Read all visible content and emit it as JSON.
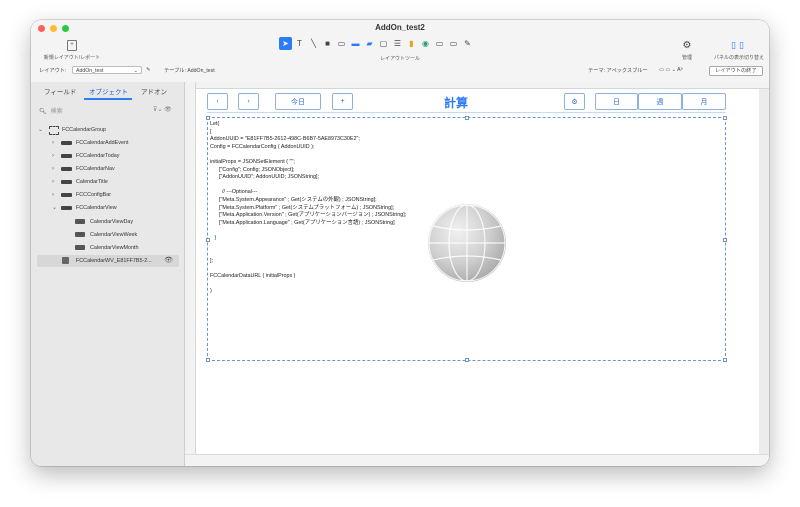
{
  "window": {
    "title": "AddOn_test2"
  },
  "toolbar": {
    "new_layout_label": "新規レイアウト/レポート",
    "tools_label": "レイアウトツール",
    "manage_label": "管理",
    "panels_label": "パネルの表示切り替え",
    "tools": [
      "pointer",
      "text",
      "line",
      "rectangle",
      "field",
      "button",
      "button-bar",
      "popover",
      "portal",
      "chart",
      "web-viewer",
      "tab-control",
      "slide-control",
      "format-painter"
    ]
  },
  "layout_bar": {
    "layout_label": "レイアウト:",
    "layout_value": "AddOn_test",
    "table_label": "テーブル: AddOn_test",
    "theme_label": "テーマ: アペックスブルー",
    "exit_label": "レイアウトの終了"
  },
  "sidebar": {
    "tabs": [
      "フィールド",
      "オブジェクト",
      "アドオン"
    ],
    "active_tab": "オブジェクト",
    "search_placeholder": "検索",
    "tree": [
      {
        "label": "FCCalendarGroup",
        "level": 0,
        "icon": "group-icon",
        "expanded": true
      },
      {
        "label": "FCCalendarAddEvent",
        "level": 1,
        "icon": "object-icon",
        "expanded": false
      },
      {
        "label": "FCCalendarToday",
        "level": 1,
        "icon": "object-icon",
        "expanded": false
      },
      {
        "label": "FCCalendarNav",
        "level": 1,
        "icon": "object-icon",
        "expanded": false
      },
      {
        "label": "CalendarTitle",
        "level": 1,
        "icon": "object-icon",
        "expanded": false
      },
      {
        "label": "FCCConfigBar",
        "level": 1,
        "icon": "object-icon",
        "expanded": false
      },
      {
        "label": "FCCalendarView",
        "level": 1,
        "icon": "object-icon",
        "expanded": true
      },
      {
        "label": "CalendarViewDay",
        "level": 2,
        "icon": "view-icon"
      },
      {
        "label": "CalendarViewWeek",
        "level": 2,
        "icon": "view-icon"
      },
      {
        "label": "CalendarViewMonth",
        "level": 2,
        "icon": "view-icon"
      },
      {
        "label": "FCCalendarWV_E81FF7B5-2...",
        "level": 1,
        "icon": "webviewer-icon",
        "selected": true
      }
    ]
  },
  "calendar": {
    "prev": "‹",
    "next": "›",
    "today": "今日",
    "add": "+",
    "title": "計算",
    "settings": "⚙",
    "day": "日",
    "week": "週",
    "month": "月"
  },
  "webviewer": {
    "code": "Let(\n[\nAddonUUID = \"E81FF7B5-2612-498C-B6B7-5AE8973C30E2\";\nConfig = FCCalendarConfig ( AddonUUID );\n\ninitialProps = JSONSetElement ( \"\";\n      [\"Config\"; Config; JSONObject];\n      [\"AddonUUID\"; AddonUUID; JSONString];\n\n        // ---Optional---\n      [\"Meta.System.Appearance\" ; Get(システムの外観) ; JSONString];\n      [\"Meta.System.Platform\" ; Get(システムプラットフォーム) ; JSONString];\n      [\"Meta.Application.Version\" ; Get(アプリケーションバージョン) ; JSONString];\n      [\"Meta.Application.Language\" ; Get(アプリケーション言語) ; JSONString]\n\n   )\n\n\n];\n\nFCCalendarDataURL ( initialProps )\n\n)"
  },
  "colors": {
    "accent": "#2b7cf6",
    "selection": "#d7d7d7"
  }
}
